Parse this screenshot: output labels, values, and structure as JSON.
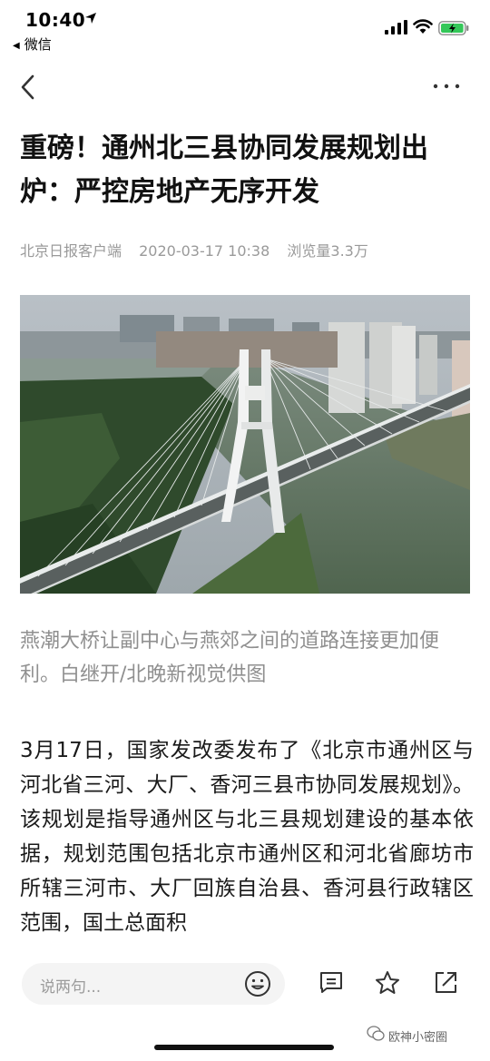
{
  "status_bar": {
    "time": "10:40",
    "back_app": "微信"
  },
  "nav": {
    "back_icon": "chevron-left-icon",
    "more_icon": "more-dots-icon"
  },
  "article": {
    "title": "重磅！通州北三县协同发展规划出炉：严控房地产无序开发",
    "source": "北京日报客户端",
    "datetime": "2020-03-17 10:38",
    "views": "浏览量3.3万",
    "caption": "燕潮大桥让副中心与燕郊之间的道路连接更加便利。白继开/北晚新视觉供图",
    "body": "3月17日，国家发改委发布了《北京市通州区与河北省三河、大厂、香河三县市协同发展规划》。该规划是指导通州区与北三县规划建设的基本依据，规划范围包括北京市通州区和河北省廊坊市所辖三河市、大厂回族自治县、香河县行政辖区范围，国土总面积"
  },
  "bottom_bar": {
    "comment_placeholder": "说两句...",
    "icons": [
      "emoji-icon",
      "comment-icon",
      "star-icon",
      "share-icon"
    ],
    "watermark": "欧神小密圈"
  }
}
